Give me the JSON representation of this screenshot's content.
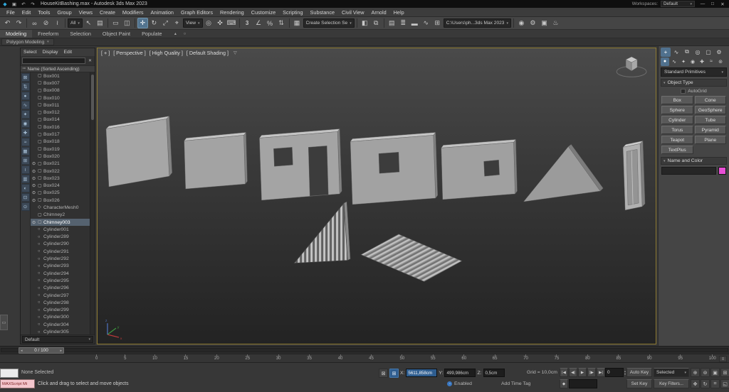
{
  "colors": {
    "object_color_swatch": "#e84fd5",
    "viewport_border": "#8d7930",
    "accent_blue": "#50718e",
    "maxscript_pink": "#f3c6cd"
  },
  "icons": {
    "search_clear": "✕",
    "sort": "≔",
    "caret_down": "▾",
    "viewport_filter": "▽",
    "autobackup_clock": "◔",
    "layout_tab": "▭",
    "slider_left": "◂",
    "slider_right": "▸",
    "spinner_up": "▴",
    "spinner_down": "▾",
    "key_mode": "◆",
    "trackbar_menu": "≡"
  },
  "title_bar": {
    "app_title": "HouseKitBashing.max - Autodesk 3ds Max 2023",
    "workspaces_label": "Workspaces:",
    "workspaces_value": "Default",
    "qat_icons": [
      {
        "name": "app-logo-icon",
        "glyph": "◆"
      },
      {
        "name": "save-icon",
        "glyph": "▣"
      },
      {
        "name": "undo-icon",
        "glyph": "↶"
      },
      {
        "name": "redo-icon",
        "glyph": "↷"
      }
    ],
    "window_buttons": [
      {
        "name": "minimize-button",
        "glyph": "—"
      },
      {
        "name": "maximize-button",
        "glyph": "□"
      },
      {
        "name": "close-button",
        "glyph": "✕"
      }
    ]
  },
  "menu_bar": {
    "items": [
      {
        "name": "menu-file",
        "label": "File"
      },
      {
        "name": "menu-edit",
        "label": "Edit"
      },
      {
        "name": "menu-tools",
        "label": "Tools"
      },
      {
        "name": "menu-group",
        "label": "Group"
      },
      {
        "name": "menu-views",
        "label": "Views"
      },
      {
        "name": "menu-create",
        "label": "Create"
      },
      {
        "name": "menu-modifiers",
        "label": "Modifiers"
      },
      {
        "name": "menu-animation",
        "label": "Animation"
      },
      {
        "name": "menu-graph-editors",
        "label": "Graph Editors"
      },
      {
        "name": "menu-rendering",
        "label": "Rendering"
      },
      {
        "name": "menu-customize",
        "label": "Customize"
      },
      {
        "name": "menu-scripting",
        "label": "Scripting"
      },
      {
        "name": "menu-substance",
        "label": "Substance"
      },
      {
        "name": "menu-civil-view",
        "label": "Civil View"
      },
      {
        "name": "menu-arnold",
        "label": "Arnold"
      },
      {
        "name": "menu-help",
        "label": "Help"
      }
    ]
  },
  "main_toolbar": {
    "items": [
      {
        "name": "undo-icon",
        "glyph": "↶"
      },
      {
        "name": "redo-icon",
        "glyph": "↷"
      },
      {
        "name": "toolbar-separator",
        "type": "sep"
      },
      {
        "name": "select-and-link-icon",
        "glyph": "∞"
      },
      {
        "name": "unlink-selection-icon",
        "glyph": "⊘"
      },
      {
        "name": "bind-to-space-warp-icon",
        "glyph": "≀"
      },
      {
        "name": "toolbar-separator",
        "type": "sep"
      },
      {
        "name": "selection-filter-combo",
        "type": "combo",
        "text": "All"
      },
      {
        "name": "select-object-icon",
        "glyph": "↖"
      },
      {
        "name": "select-by-name-icon",
        "glyph": "▤"
      },
      {
        "name": "toolbar-separator",
        "type": "sep"
      },
      {
        "name": "rectangular-selection-icon",
        "glyph": "▭"
      },
      {
        "name": "window-crossing-icon",
        "glyph": "◫"
      },
      {
        "name": "toolbar-separator",
        "type": "sep"
      },
      {
        "name": "select-and-move-icon",
        "glyph": "✛",
        "active": true
      },
      {
        "name": "select-and-rotate-icon",
        "glyph": "↻"
      },
      {
        "name": "select-and-scale-icon",
        "glyph": "⤢"
      },
      {
        "name": "select-and-place-icon",
        "glyph": "⌖"
      },
      {
        "name": "reference-coordinate-combo",
        "type": "combo",
        "text": "View"
      },
      {
        "name": "use-pivot-center-icon",
        "glyph": "◎"
      },
      {
        "name": "select-and-manipulate-icon",
        "glyph": "✜"
      },
      {
        "name": "keyboard-override-icon",
        "glyph": "⌨"
      },
      {
        "name": "toolbar-separator",
        "type": "sep"
      },
      {
        "name": "snaps-toggle-icon",
        "glyph": "3"
      },
      {
        "name": "angle-snap-icon",
        "glyph": "∠"
      },
      {
        "name": "percent-snap-icon",
        "glyph": "%"
      },
      {
        "name": "spinner-snap-icon",
        "glyph": "⇅"
      },
      {
        "name": "toolbar-separator",
        "type": "sep"
      },
      {
        "name": "edit-named-selection-sets-icon",
        "glyph": "▦"
      },
      {
        "name": "named-selection-sets-combo",
        "type": "combo",
        "text": "Create Selection Se"
      },
      {
        "name": "toolbar-separator",
        "type": "sep"
      },
      {
        "name": "mirror-icon",
        "glyph": "◧"
      },
      {
        "name": "align-icon",
        "glyph": "⧉"
      },
      {
        "name": "toolbar-separator",
        "type": "sep"
      },
      {
        "name": "toggle-scene-explorer-icon",
        "glyph": "▤"
      },
      {
        "name": "toggle-layer-explorer-icon",
        "glyph": "≣"
      },
      {
        "name": "toggle-ribbon-icon",
        "glyph": "▬"
      },
      {
        "name": "curve-editor-icon",
        "glyph": "∿"
      },
      {
        "name": "schematic-view-icon",
        "glyph": "⊞"
      },
      {
        "name": "project-folder-combo",
        "type": "combo",
        "text": "C:\\Users\\ph...3ds Max 2023"
      },
      {
        "name": "toolbar-separator",
        "type": "sep"
      },
      {
        "name": "material-editor-icon",
        "glyph": "◉"
      },
      {
        "name": "render-setup-icon",
        "glyph": "⚙"
      },
      {
        "name": "rendered-frame-icon",
        "glyph": "▣"
      },
      {
        "name": "render-production-icon",
        "glyph": "♨"
      }
    ]
  },
  "ribbon": {
    "tabs": [
      {
        "name": "ribbon-tab-modeling",
        "label": "Modeling",
        "active": true
      },
      {
        "name": "ribbon-tab-freeform",
        "label": "Freeform"
      },
      {
        "name": "ribbon-tab-selection",
        "label": "Selection"
      },
      {
        "name": "ribbon-tab-object-paint",
        "label": "Object Paint"
      },
      {
        "name": "ribbon-tab-populate",
        "label": "Populate"
      }
    ],
    "extra_icons": [
      {
        "name": "ribbon-minimize-icon",
        "glyph": "▴"
      },
      {
        "name": "ribbon-config-icon",
        "glyph": "○"
      }
    ],
    "panel_label": "Polygon Modeling"
  },
  "scene_explorer": {
    "menu_items": [
      {
        "name": "explorer-menu-select",
        "label": "Select"
      },
      {
        "name": "explorer-menu-display",
        "label": "Display"
      },
      {
        "name": "explorer-menu-edit",
        "label": "Edit"
      }
    ],
    "search_placeholder": "",
    "sort_header": "Name (Sorted Ascending)",
    "footer_value": "Default",
    "toolbar_icons": [
      {
        "name": "explorer-lock-icon",
        "glyph": "⊠"
      },
      {
        "name": "explorer-sync-icon",
        "glyph": "⇅"
      },
      {
        "name": "filter-geometry-icon",
        "glyph": "●"
      },
      {
        "name": "filter-shapes-icon",
        "glyph": "∿"
      },
      {
        "name": "filter-lights-icon",
        "glyph": "✦"
      },
      {
        "name": "filter-cameras-icon",
        "glyph": "◉"
      },
      {
        "name": "filter-helpers-icon",
        "glyph": "✚"
      },
      {
        "name": "filter-spacewarps-icon",
        "glyph": "≈"
      },
      {
        "name": "filter-groups-icon",
        "glyph": "▦"
      },
      {
        "name": "filter-xrefs-icon",
        "glyph": "⊞"
      },
      {
        "name": "filter-bones-icon",
        "glyph": "≀"
      },
      {
        "name": "filter-containers-icon",
        "glyph": "▥"
      },
      {
        "name": "filter-materials-icon",
        "glyph": "◐"
      },
      {
        "name": "filter-selection-icon",
        "glyph": "⊡"
      },
      {
        "name": "explorer-find-icon",
        "glyph": "⊙"
      }
    ],
    "items": [
      {
        "label": "Box001",
        "icon": "▢"
      },
      {
        "label": "Box007",
        "icon": "▢"
      },
      {
        "label": "Box008",
        "icon": "▢"
      },
      {
        "label": "Box010",
        "icon": "▢"
      },
      {
        "label": "Box011",
        "icon": "▢"
      },
      {
        "label": "Box012",
        "icon": "▢"
      },
      {
        "label": "Box014",
        "icon": "▢"
      },
      {
        "label": "Box016",
        "icon": "▢"
      },
      {
        "label": "Box017",
        "icon": "▢"
      },
      {
        "label": "Box018",
        "icon": "▢"
      },
      {
        "label": "Box019",
        "icon": "▢"
      },
      {
        "label": "Box020",
        "icon": "▢"
      },
      {
        "label": "Box021",
        "icon": "▢",
        "eye": true,
        "eye_glyph": "⊙"
      },
      {
        "label": "Box022",
        "icon": "▢",
        "eye": true,
        "eye_glyph": "⊙"
      },
      {
        "label": "Box023",
        "icon": "▢",
        "eye": true,
        "eye_glyph": "⊙"
      },
      {
        "label": "Box024",
        "icon": "▢",
        "eye": true,
        "eye_glyph": "⊙"
      },
      {
        "label": "Box025",
        "icon": "▢",
        "eye": true,
        "eye_glyph": "⊙"
      },
      {
        "label": "Box026",
        "icon": "▢",
        "eye": true,
        "eye_glyph": "⊙"
      },
      {
        "label": "CharacterMesh0",
        "icon": "◇"
      },
      {
        "label": "Chimney2",
        "icon": "▢"
      },
      {
        "label": "Chimney003",
        "icon": "▢",
        "eye": true,
        "eye_glyph": "⊙",
        "selected": true
      },
      {
        "label": "Cylinder001",
        "icon": "○"
      },
      {
        "label": "Cylinder289",
        "icon": "○"
      },
      {
        "label": "Cylinder290",
        "icon": "○"
      },
      {
        "label": "Cylinder291",
        "icon": "○"
      },
      {
        "label": "Cylinder292",
        "icon": "○"
      },
      {
        "label": "Cylinder293",
        "icon": "○"
      },
      {
        "label": "Cylinder294",
        "icon": "○"
      },
      {
        "label": "Cylinder295",
        "icon": "○"
      },
      {
        "label": "Cylinder296",
        "icon": "○"
      },
      {
        "label": "Cylinder297",
        "icon": "○"
      },
      {
        "label": "Cylinder298",
        "icon": "○"
      },
      {
        "label": "Cylinder299",
        "icon": "○"
      },
      {
        "label": "Cylinder300",
        "icon": "○"
      },
      {
        "label": "Cylinder304",
        "icon": "○"
      },
      {
        "label": "Cylinder305",
        "icon": "○"
      }
    ]
  },
  "viewport": {
    "menus": [
      {
        "name": "viewport-general-menu",
        "label": "[ + ]"
      },
      {
        "name": "viewport-pov-menu",
        "label": "[ Perspective ]"
      },
      {
        "name": "viewport-quality-menu",
        "label": "[ High Quality ]"
      },
      {
        "name": "viewport-shading-menu",
        "label": "[ Default Shading ]"
      }
    ]
  },
  "command_panel": {
    "tabs": [
      {
        "name": "create-tab-icon",
        "glyph": "+",
        "active": true
      },
      {
        "name": "modify-tab-icon",
        "glyph": "∿"
      },
      {
        "name": "hierarchy-tab-icon",
        "glyph": "⧉"
      },
      {
        "name": "motion-tab-icon",
        "glyph": "◎"
      },
      {
        "name": "display-tab-icon",
        "glyph": "▢"
      },
      {
        "name": "utilities-tab-icon",
        "glyph": "⚙"
      }
    ],
    "categories": [
      {
        "name": "geometry-category-icon",
        "glyph": "●",
        "active": true
      },
      {
        "name": "shapes-category-icon",
        "glyph": "∿"
      },
      {
        "name": "lights-category-icon",
        "glyph": "✦"
      },
      {
        "name": "cameras-category-icon",
        "glyph": "◉"
      },
      {
        "name": "helpers-category-icon",
        "glyph": "✚"
      },
      {
        "name": "spacewarps-category-icon",
        "glyph": "≈"
      },
      {
        "name": "systems-category-icon",
        "glyph": "⊚"
      }
    ],
    "dropdown_value": "Standard Primitives",
    "rollouts": {
      "object_type": "Object Type",
      "name_and_color": "Name and Color"
    },
    "autogrid_label": "AutoGrid",
    "object_buttons": [
      {
        "name": "primitive-box-button",
        "label": "Box"
      },
      {
        "name": "primitive-cone-button",
        "label": "Cone"
      },
      {
        "name": "primitive-sphere-button",
        "label": "Sphere"
      },
      {
        "name": "primitive-geosphere-button",
        "label": "GeoSphere"
      },
      {
        "name": "primitive-cylinder-button",
        "label": "Cylinder"
      },
      {
        "name": "primitive-tube-button",
        "label": "Tube"
      },
      {
        "name": "primitive-torus-button",
        "label": "Torus"
      },
      {
        "name": "primitive-pyramid-button",
        "label": "Pyramid"
      },
      {
        "name": "primitive-teapot-button",
        "label": "Teapot"
      },
      {
        "name": "primitive-plane-button",
        "label": "Plane"
      },
      {
        "name": "primitive-textplus-button",
        "label": "TextPlus"
      }
    ],
    "name_field_value": ""
  },
  "timeline": {
    "slider_label": "0 / 100",
    "ticks": [
      "0",
      "5",
      "10",
      "15",
      "20",
      "25",
      "30",
      "35",
      "40",
      "45",
      "50",
      "55",
      "60",
      "65",
      "70",
      "75",
      "80",
      "85",
      "90",
      "95",
      "100"
    ]
  },
  "status_bar": {
    "maxscript_label": "MAXScript Mi",
    "selection_status": "None Selected",
    "prompt": "Click and drag to select and move objects",
    "autobackup_label": "Enabled",
    "add_time_tag": "Add Time Tag",
    "grid_label": "Grid = 10,0cm",
    "x_label": "X:",
    "y_label": "Y:",
    "z_label": "Z:",
    "x_value": "5611,858cm",
    "y_value": "499,986cm",
    "z_value": "0,5cm",
    "frame_value": "0",
    "auto_key": "Auto Key",
    "set_key": "Set Key",
    "selected_combo": "Selected",
    "key_filters": "Key Filters...",
    "playback_icons": [
      {
        "name": "go-to-start-icon",
        "glyph": "|◀"
      },
      {
        "name": "previous-frame-icon",
        "glyph": "◀|"
      },
      {
        "name": "play-animation-icon",
        "glyph": "▶"
      },
      {
        "name": "next-frame-icon",
        "glyph": "|▶"
      },
      {
        "name": "go-to-end-icon",
        "glyph": "▶|"
      }
    ],
    "nav_icons_row1": [
      {
        "name": "zoom-icon",
        "glyph": "⊕"
      },
      {
        "name": "zoom-all-icon",
        "glyph": "⊚"
      },
      {
        "name": "zoom-extents-icon",
        "glyph": "▣"
      },
      {
        "name": "zoom-extents-all-icon",
        "glyph": "⊞"
      }
    ],
    "nav_icons_row2": [
      {
        "name": "pan-icon",
        "glyph": "✥"
      },
      {
        "name": "orbit-icon",
        "glyph": "↻"
      },
      {
        "name": "zoom-region-icon",
        "glyph": "⌗"
      },
      {
        "name": "maximize-viewport-icon",
        "glyph": "◱"
      }
    ]
  }
}
